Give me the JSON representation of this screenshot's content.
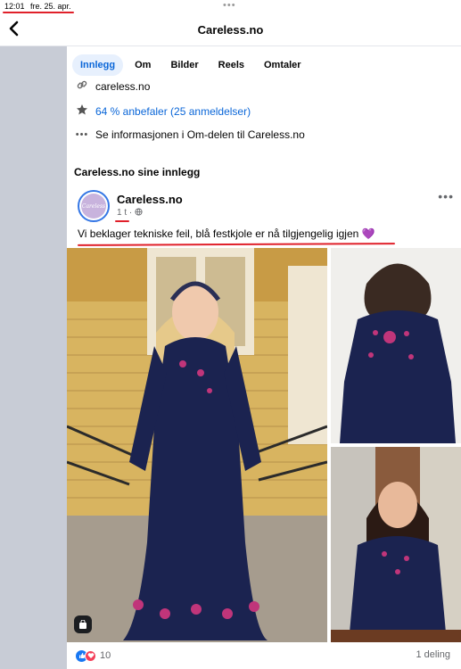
{
  "status": {
    "time": "12:01",
    "date": "fre. 25. apr.",
    "dots": "•••"
  },
  "nav": {
    "back": "‹",
    "title": "Careless.no"
  },
  "tabs": [
    "Innlegg",
    "Om",
    "Bilder",
    "Reels",
    "Omtaler"
  ],
  "info": {
    "website": "careless.no",
    "rating": "64 % anbefaler (25 anmeldelser)",
    "about": "Se informasjonen i Om-delen til Careless.no"
  },
  "section_title": "Careless.no sine innlegg",
  "post": {
    "author": "Careless.no",
    "avatar_text": "Careless",
    "time": "1 t",
    "privacy_icon": "globe-icon",
    "text": "Vi beklager tekniske feil, blå festkjole er nå tilgjengelig igjen 💜",
    "reactions_count": "10",
    "shares": "1 deling"
  },
  "colors": {
    "accent": "#0a66d8",
    "annotation": "#e0202a",
    "dress": "#1b2350"
  }
}
